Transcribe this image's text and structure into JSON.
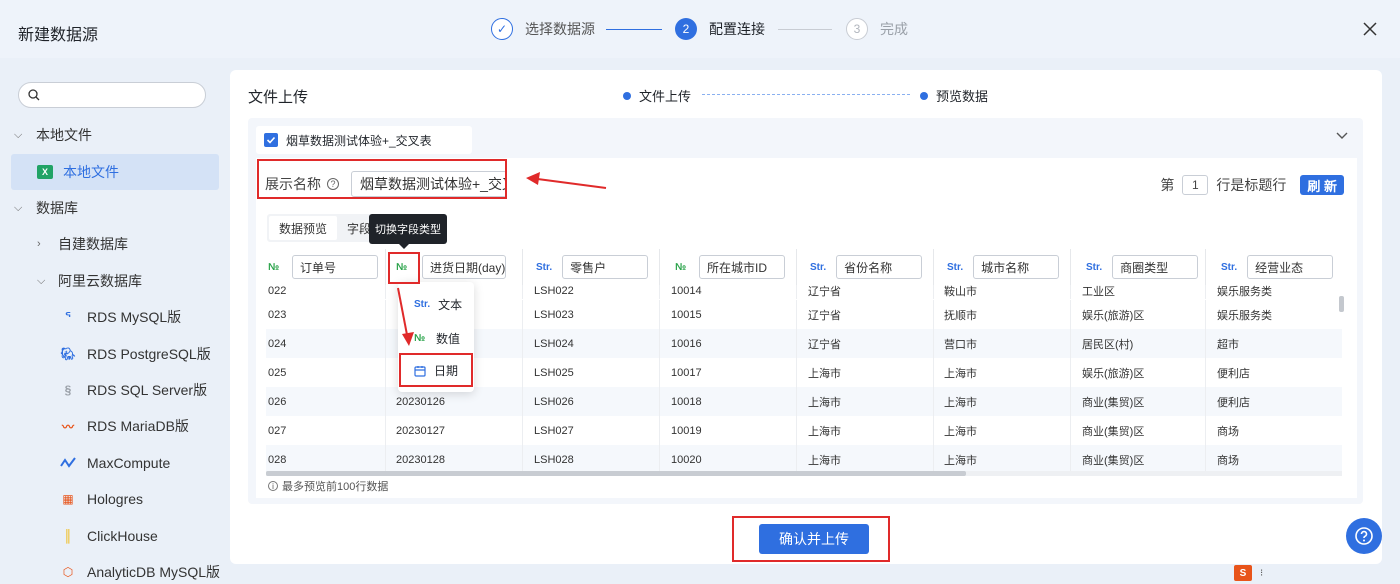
{
  "window": {
    "title": "新建数据源"
  },
  "steps": [
    {
      "label": "选择数据源",
      "index": "✓",
      "state": "done"
    },
    {
      "label": "配置连接",
      "index": "2",
      "state": "active"
    },
    {
      "label": "完成",
      "index": "3",
      "state": "todo"
    }
  ],
  "sidebar": {
    "search_placeholder": "",
    "groups": [
      {
        "label": "本地文件",
        "expanded": true
      },
      {
        "label": "数据库",
        "expanded": true
      }
    ],
    "local_item": "本地文件",
    "subgroups": [
      {
        "label": "自建数据库",
        "expanded": false
      },
      {
        "label": "阿里云数据库",
        "expanded": true
      }
    ],
    "datasources": [
      {
        "label": "RDS MySQL版",
        "icon": "mysql-icon"
      },
      {
        "label": "RDS PostgreSQL版",
        "icon": "postgresql-icon"
      },
      {
        "label": "RDS SQL Server版",
        "icon": "sqlserver-icon"
      },
      {
        "label": "RDS MariaDB版",
        "icon": "mariadb-icon"
      },
      {
        "label": "MaxCompute",
        "icon": "maxcompute-icon"
      },
      {
        "label": "Hologres",
        "icon": "hologres-icon"
      },
      {
        "label": "ClickHouse",
        "icon": "clickhouse-icon"
      },
      {
        "label": "AnalyticDB MySQL版",
        "icon": "analyticdb-icon"
      }
    ]
  },
  "panel": {
    "title": "文件上传",
    "substeps": [
      "文件上传",
      "预览数据"
    ],
    "file": {
      "name": "烟草数据测试体验+_交叉表",
      "checked": true
    },
    "display_name_label": "展示名称",
    "display_name_value": "烟草数据测试体验+_交叉",
    "header_row": {
      "prefix": "第",
      "value": "1",
      "suffix": "行是标题行"
    },
    "refresh_label": "刷 新",
    "tabs": [
      "数据预览",
      "字段"
    ],
    "tooltip": "切换字段类型",
    "note": "最多预览前100行数据",
    "confirm_label": "确认并上传"
  },
  "columns": [
    {
      "type": "№",
      "kind": "num",
      "name": "订单号"
    },
    {
      "type": "№",
      "kind": "num",
      "name": "进货日期(day)"
    },
    {
      "type": "Str.",
      "kind": "str",
      "name": "零售户"
    },
    {
      "type": "№",
      "kind": "num",
      "name": "所在城市ID"
    },
    {
      "type": "Str.",
      "kind": "str",
      "name": "省份名称"
    },
    {
      "type": "Str.",
      "kind": "str",
      "name": "城市名称"
    },
    {
      "type": "Str.",
      "kind": "str",
      "name": "商圈类型"
    },
    {
      "type": "Str.",
      "kind": "str",
      "name": "经营业态"
    }
  ],
  "rows": [
    [
      "022",
      "",
      "LSH022",
      "10014",
      "辽宁省",
      "鞍山市",
      "工业区",
      "娱乐服务类"
    ],
    [
      "023",
      "",
      "LSH023",
      "10015",
      "辽宁省",
      "抚顺市",
      "娱乐(旅游)区",
      "娱乐服务类"
    ],
    [
      "024",
      "",
      "LSH024",
      "10016",
      "辽宁省",
      "营口市",
      "居民区(村)",
      "超市"
    ],
    [
      "025",
      "",
      "LSH025",
      "10017",
      "上海市",
      "上海市",
      "娱乐(旅游)区",
      "便利店"
    ],
    [
      "026",
      "20230126",
      "LSH026",
      "10018",
      "上海市",
      "上海市",
      "商业(集贸)区",
      "便利店"
    ],
    [
      "027",
      "20230127",
      "LSH027",
      "10019",
      "上海市",
      "上海市",
      "商业(集贸)区",
      "商场"
    ],
    [
      "028",
      "20230128",
      "LSH028",
      "10020",
      "上海市",
      "上海市",
      "商业(集贸)区",
      "商场"
    ]
  ],
  "type_menu": [
    {
      "tag": "Str.",
      "label": "文本",
      "icon": "text-type-icon"
    },
    {
      "tag": "№",
      "label": "数值",
      "icon": "number-type-icon"
    },
    {
      "tag": "",
      "label": "日期",
      "icon": "calendar-icon"
    }
  ],
  "colors": {
    "accent": "#2f6fe0",
    "annotation": "#e02a2a",
    "numeric_tag": "#2aa34a"
  }
}
